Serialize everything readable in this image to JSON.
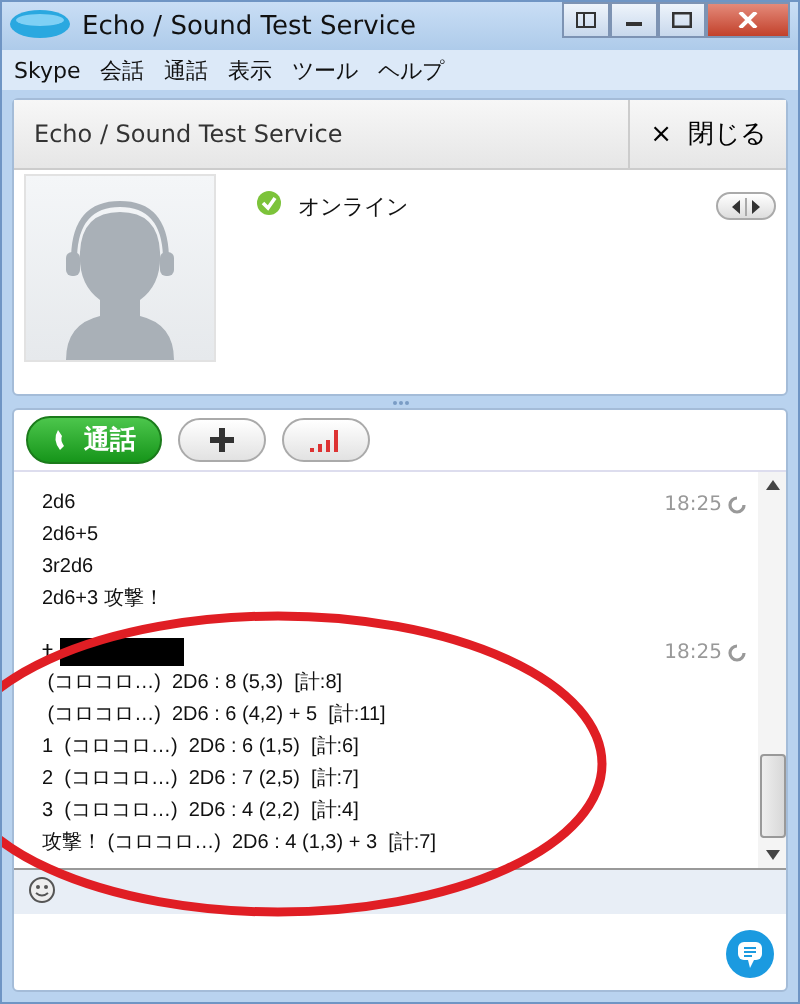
{
  "window": {
    "title": "Echo / Sound Test Service"
  },
  "menu": [
    {
      "label": "Skype"
    },
    {
      "label": "会話"
    },
    {
      "label": "通話"
    },
    {
      "label": "表示"
    },
    {
      "label": "ツール"
    },
    {
      "label": "ヘルプ"
    }
  ],
  "header": {
    "title": "Echo / Sound Test Service",
    "close_icon": "×",
    "close_label": "閉じる"
  },
  "profile": {
    "status": "オンライン"
  },
  "toolbar": {
    "call_label": "通話"
  },
  "messages": [
    {
      "time": "18:25",
      "lines": [
        "2d6",
        "2d6+5",
        "3r2d6",
        "2d6+3 攻撃！"
      ]
    },
    {
      "time": "18:25",
      "sender_mark": "†",
      "redacted": true,
      "lines": [
        " (コロコロ…)  2D6 : 8 (5,3)  [計:8]",
        " (コロコロ…)  2D6 : 6 (4,2) + 5  [計:11]",
        "1  (コロコロ…)  2D6 : 6 (1,5)  [計:6]",
        "2  (コロコロ…)  2D6 : 7 (2,5)  [計:7]",
        "3  (コロコロ…)  2D6 : 4 (2,2)  [計:4]",
        "攻撃！ (コロコロ…)  2D6 : 4 (1,3) + 3  [計:7]"
      ]
    }
  ]
}
